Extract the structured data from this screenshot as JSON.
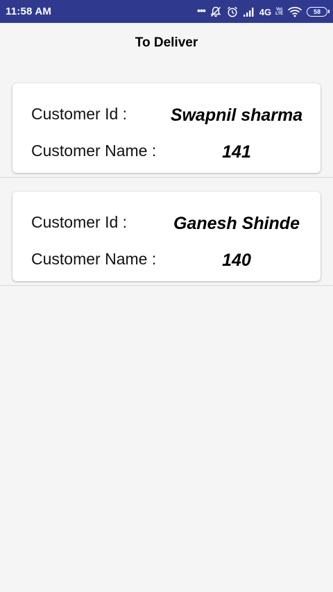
{
  "status_bar": {
    "time": "11:58 AM",
    "network": "4G",
    "volte_line1": "Vo)",
    "volte_line2": "LTE",
    "battery": "58"
  },
  "toolbar": {
    "title": "To Deliver"
  },
  "deliveries": [
    {
      "id_label": "Customer Id :",
      "id_value": "Swapnil sharma",
      "name_label": "Customer Name :",
      "name_value": "141"
    },
    {
      "id_label": "Customer Id :",
      "id_value": "Ganesh Shinde",
      "name_label": "Customer Name :",
      "name_value": "140"
    }
  ]
}
